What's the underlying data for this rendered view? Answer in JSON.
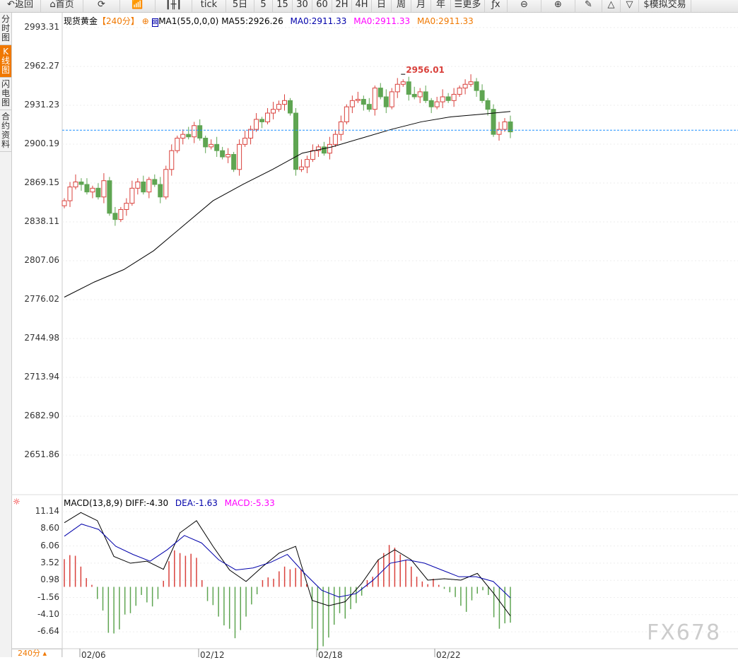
{
  "toolbar": [
    {
      "label": "↶返回",
      "name": "back"
    },
    {
      "label": "⌂首页",
      "name": "home"
    },
    {
      "label": "⟳",
      "name": "refresh"
    },
    {
      "label": "📶",
      "name": "indicator"
    },
    {
      "label": "┃╫┃",
      "name": "candle-type"
    },
    {
      "label": "tick",
      "name": "tick"
    },
    {
      "label": "5日",
      "name": "5day"
    },
    {
      "label": "5",
      "name": "5min"
    },
    {
      "label": "15",
      "name": "15min"
    },
    {
      "label": "30",
      "name": "30min"
    },
    {
      "label": "60",
      "name": "60min"
    },
    {
      "label": "2H",
      "name": "2h"
    },
    {
      "label": "4H",
      "name": "4h"
    },
    {
      "label": "日",
      "name": "day"
    },
    {
      "label": "周",
      "name": "week"
    },
    {
      "label": "月",
      "name": "month"
    },
    {
      "label": "年",
      "name": "year"
    },
    {
      "label": "☰更多",
      "name": "more"
    },
    {
      "label": "ƒx",
      "name": "formula"
    },
    {
      "label": "⊖",
      "name": "zoom-out"
    },
    {
      "label": "⊕",
      "name": "zoom-in"
    },
    {
      "label": "✎",
      "name": "draw"
    },
    {
      "label": "△",
      "name": "up"
    },
    {
      "label": "▽",
      "name": "down"
    },
    {
      "label": "$模拟交易",
      "name": "sim-trade"
    }
  ],
  "sidebar": [
    {
      "label": "分时图"
    },
    {
      "label": "K线图"
    },
    {
      "label": "闪电图"
    },
    {
      "label": "合约资料"
    }
  ],
  "header": {
    "symbol": "现货黄金",
    "period": "【240分】",
    "ma_name": "MA1(55,0,0,0)",
    "ma55": "MA55:2926.26",
    "ma0a": "MA0:2911.33",
    "ma0b": "MA0:2911.33",
    "ma0c": "MA0:2911.33"
  },
  "macd_header": {
    "name": "MACD(13,8,9)",
    "diff": "DIFF:-4.30",
    "dea": "DEA:-1.63",
    "macd": "MACD:-5.33"
  },
  "period_label": "240分",
  "watermark": "FX678",
  "colors": {
    "up": "#d9413c",
    "down": "#5fa552",
    "ma": "#000000",
    "dea": "#0000aa",
    "accent": "#f07800"
  },
  "chart_data": {
    "type": "candlestick",
    "price_ticks": [
      "2993.31",
      "2962.27",
      "2931.23",
      "2900.19",
      "2869.15",
      "2838.11",
      "2807.06",
      "2776.02",
      "2744.98",
      "2713.94",
      "2682.90",
      "2651.86"
    ],
    "ylim": [
      2651.86,
      2993.31
    ],
    "last_price": 2911.33,
    "high_label": "2956.01",
    "closes": [
      2855,
      2866,
      2870,
      2868,
      2862,
      2865,
      2858,
      2871,
      2845,
      2840,
      2848,
      2853,
      2865,
      2870,
      2862,
      2872,
      2868,
      2858,
      2880,
      2895,
      2905,
      2908,
      2906,
      2915,
      2905,
      2898,
      2900,
      2895,
      2890,
      2892,
      2880,
      2900,
      2905,
      2912,
      2920,
      2918,
      2925,
      2928,
      2932,
      2935,
      2925,
      2880,
      2882,
      2888,
      2895,
      2898,
      2893,
      2900,
      2908,
      2918,
      2930,
      2935,
      2936,
      2932,
      2928,
      2945,
      2938,
      2930,
      2942,
      2948,
      2950,
      2940,
      2938,
      2942,
      2935,
      2930,
      2934,
      2938,
      2935,
      2940,
      2945,
      2948,
      2950,
      2943,
      2935,
      2928,
      2908,
      2912,
      2918,
      2910
    ],
    "ma55_keypoints": [
      2778,
      2790,
      2800,
      2815,
      2835,
      2855,
      2868,
      2880,
      2893,
      2898,
      2905,
      2912,
      2918,
      2922,
      2924,
      2926.26
    ],
    "date_labels": [
      "02/06",
      "02/12",
      "02/18",
      "02/22"
    ],
    "macd_ticks": [
      "11.14",
      "8.60",
      "6.06",
      "3.52",
      "0.98",
      "-1.56",
      "-4.10",
      "-6.64"
    ],
    "macd_ylim": [
      -9.2,
      11.14
    ],
    "hist": [
      4.1,
      4.7,
      4.6,
      3,
      1.3,
      0.3,
      -1.8,
      -3.5,
      -6.8,
      -6.9,
      -6.3,
      -4.1,
      -3.9,
      -2.8,
      -1.2,
      -2.3,
      -2.9,
      -1.8,
      0.9,
      3.8,
      5.4,
      5.0,
      4.6,
      4.9,
      4.3,
      1.0,
      -2.1,
      -2.7,
      -4.4,
      -5.7,
      -6.2,
      -7.6,
      -6.4,
      -4.4,
      -2.6,
      -1.1,
      1.0,
      1.4,
      1.2,
      2.3,
      3.0,
      2.6,
      2.8,
      2.6,
      0.4,
      -6.2,
      -9.4,
      -8.8,
      -7.5,
      -5.6,
      -3.9,
      -4.7,
      -3.3,
      -2.4,
      -1.3,
      1.0,
      1.5,
      4.0,
      5.0,
      6.2,
      5.8,
      4.8,
      4.0,
      3.0,
      1.5,
      0.8,
      0.4,
      1.2,
      0.3,
      -0.3,
      -0.8,
      -1.5,
      -2.8,
      -3.7,
      -2.0,
      -1.0,
      -0.5,
      -1.2,
      -4.5,
      -6.2,
      -5.4,
      -5.3
    ],
    "diff_keypoints": [
      9.5,
      11,
      9.8,
      4.5,
      3.5,
      3.8,
      2.6,
      8,
      9.8,
      6,
      2.5,
      0.8,
      3,
      5,
      6,
      -2,
      -2.8,
      -2.2,
      0.5,
      4,
      5.5,
      4,
      1,
      1.2,
      1,
      2,
      -1,
      -4.3
    ],
    "dea_keypoints": [
      7.5,
      9.3,
      8.5,
      6,
      4.8,
      3.8,
      5.5,
      7.6,
      6.5,
      4,
      2.5,
      2.8,
      3.6,
      4.8,
      2,
      -0.5,
      -1.5,
      -1,
      1,
      3.5,
      4,
      3.5,
      2.5,
      1.5,
      1.5,
      0.8,
      -1.63
    ]
  }
}
